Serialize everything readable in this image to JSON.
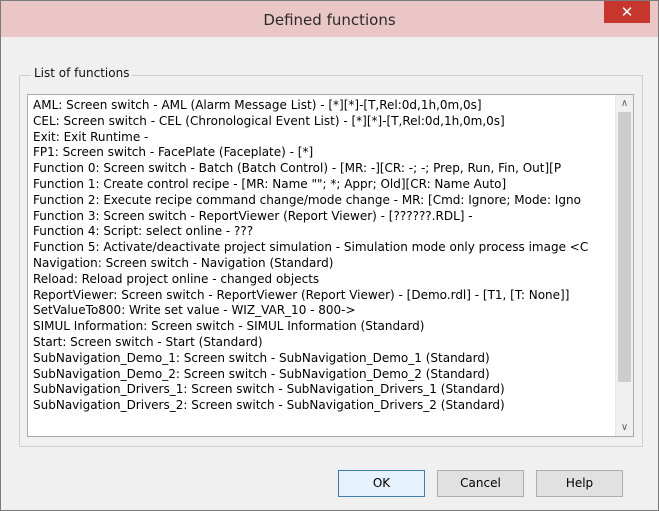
{
  "window": {
    "title": "Defined functions",
    "close_glyph": "✕"
  },
  "group": {
    "label": "List of functions"
  },
  "functions": [
    "AML: Screen switch - AML (Alarm Message List) - [*][*]-[T,Rel:0d,1h,0m,0s]",
    "CEL: Screen switch - CEL (Chronological Event List) - [*][*]-[T,Rel:0d,1h,0m,0s]",
    "Exit: Exit Runtime -",
    "FP1: Screen switch - FacePlate (Faceplate) - [*]",
    "Function 0: Screen switch - Batch (Batch Control) - [MR: -][CR: -; -; Prep, Run, Fin, Out][P",
    "Function 1: Create control recipe - [MR: Name \"\"; *; Appr; Old][CR: Name Auto]",
    "Function 2: Execute recipe command change/mode change - MR: [Cmd: Ignore; Mode: Igno",
    "Function 3: Screen switch - ReportViewer (Report Viewer) - [??????.RDL] -",
    "Function 4: Script: select online - ???",
    "Function 5: Activate/deactivate project simulation - Simulation mode only process image <C",
    "Navigation: Screen switch - Navigation (Standard)",
    "Reload: Reload project online - changed objects",
    "ReportViewer: Screen switch - ReportViewer (Report Viewer) - [Demo.rdl] - [T1, [T: None]]",
    "SetValueTo800: Write set value - WIZ_VAR_10 - 800->",
    "SIMUL Information: Screen switch - SIMUL Information (Standard)",
    "Start: Screen switch - Start (Standard)",
    "SubNavigation_Demo_1: Screen switch - SubNavigation_Demo_1 (Standard)",
    "SubNavigation_Demo_2: Screen switch - SubNavigation_Demo_2 (Standard)",
    "SubNavigation_Drivers_1: Screen switch - SubNavigation_Drivers_1 (Standard)",
    "SubNavigation_Drivers_2: Screen switch - SubNavigation_Drivers_2 (Standard)"
  ],
  "scrollbar": {
    "up_glyph": "∧",
    "down_glyph": "∨"
  },
  "buttons": {
    "ok": "OK",
    "cancel": "Cancel",
    "help": "Help"
  }
}
